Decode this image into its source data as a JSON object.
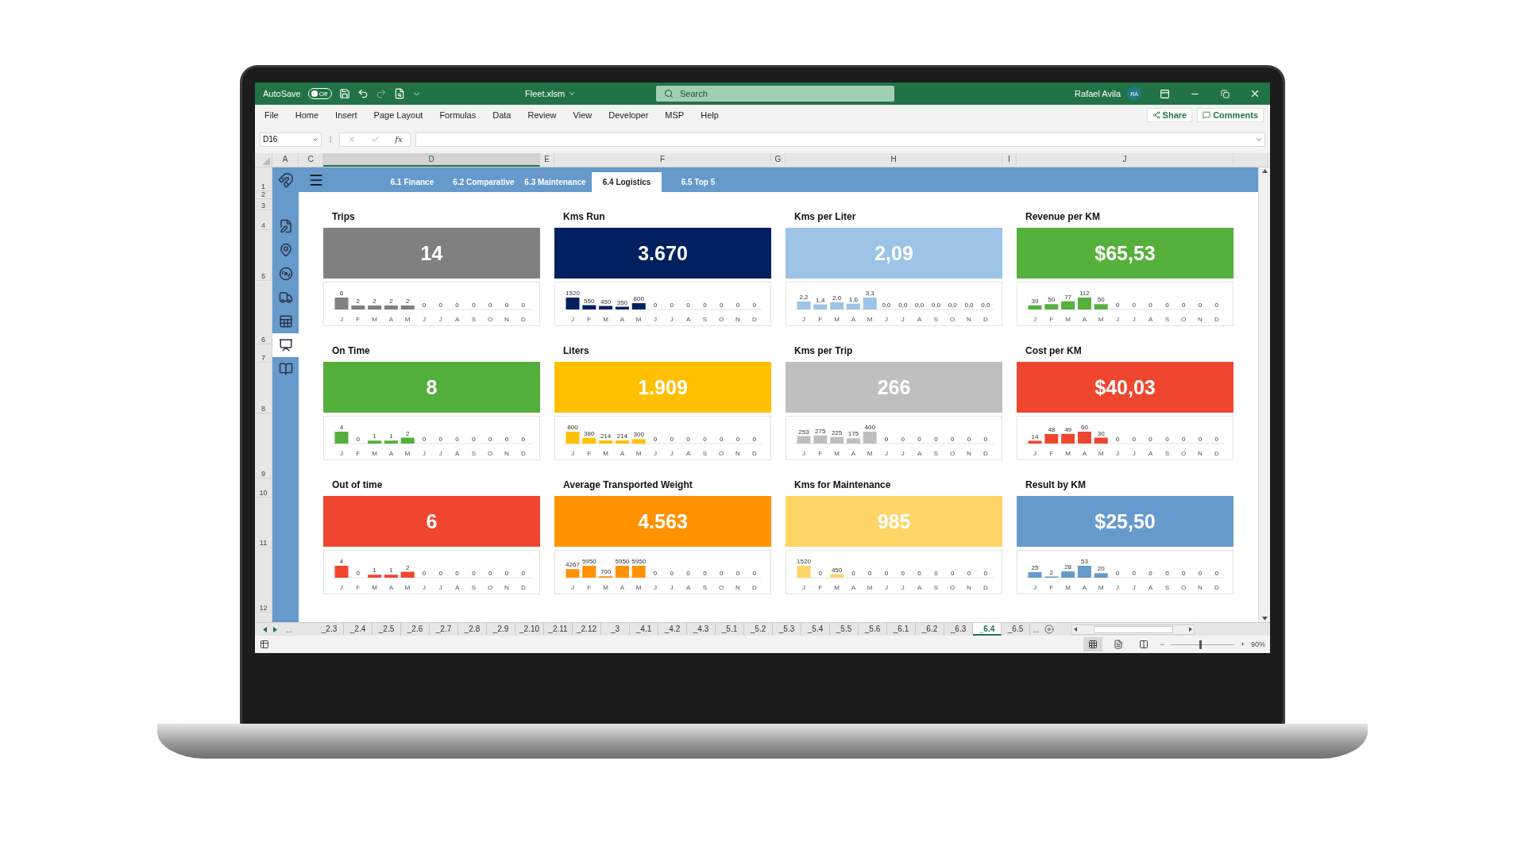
{
  "title_bar": {
    "autosave_label": "AutoSave",
    "autosave": {
      "on": false,
      "label": "Off"
    },
    "redo": {
      "disabled": true
    },
    "file_name": "Fleet.xlsm",
    "search": {
      "placeholder": "Search"
    },
    "user_name": "Rafael Avila",
    "user_initials": "RA"
  },
  "menu": {
    "items": [
      "File",
      "Home",
      "Insert",
      "Page Layout",
      "Formulas",
      "Data",
      "Review",
      "View",
      "Developer",
      "MSP",
      "Help"
    ],
    "buttons": [
      "Share",
      "Comments"
    ]
  },
  "formula_bar": {
    "name_box": "D16",
    "function_label": "fx"
  },
  "column_headers": [
    {
      "label": "A",
      "selected": false
    },
    {
      "label": "C",
      "selected": false
    },
    {
      "label": "D",
      "selected": true
    },
    {
      "label": "E",
      "selected": false
    },
    {
      "label": "F",
      "selected": false
    },
    {
      "label": "G",
      "selected": false
    },
    {
      "label": "H",
      "selected": false
    },
    {
      "label": "I",
      "selected": false
    },
    {
      "label": "J",
      "selected": false
    }
  ],
  "row_headers": [
    "1",
    "2",
    "3",
    "4",
    "5",
    "6",
    "7",
    "8",
    "9",
    "10",
    "11",
    "12"
  ],
  "dashboard": {
    "tabs": [
      {
        "label": "6.1 Finance",
        "selected": false
      },
      {
        "label": "6.2 Comparative",
        "selected": false
      },
      {
        "label": "6.3 Maintenance",
        "selected": false
      },
      {
        "label": "6.4 Logistics",
        "selected": true
      },
      {
        "label": "6.5 Top 5",
        "selected": false
      }
    ],
    "sidebar": [
      {
        "selected": false
      },
      {
        "selected": false
      },
      {
        "selected": false
      },
      {
        "selected": false
      },
      {
        "selected": false
      },
      {
        "selected": true
      },
      {
        "selected": false
      }
    ],
    "cards": [
      {
        "title": "Trips",
        "value": "14",
        "color": "#808080",
        "chart_data": {
          "type": "bar",
          "categories": [
            "J",
            "F",
            "M",
            "A",
            "M",
            "J",
            "J",
            "A",
            "S",
            "O",
            "N",
            "D"
          ],
          "values": [
            6,
            2,
            2,
            2,
            2,
            0,
            0,
            0,
            0,
            0,
            0,
            0
          ],
          "value_labels": [
            "6",
            "2",
            "2",
            "2",
            "2",
            "0",
            "0",
            "0",
            "0",
            "0",
            "0",
            "0"
          ]
        }
      },
      {
        "title": "Kms Run",
        "value": "3.670",
        "color": "#002060",
        "chart_data": {
          "type": "bar",
          "categories": [
            "J",
            "F",
            "M",
            "A",
            "M",
            "J",
            "J",
            "A",
            "S",
            "O",
            "N",
            "D"
          ],
          "values": [
            1520,
            550,
            450,
            350,
            800,
            0,
            0,
            0,
            0,
            0,
            0,
            0
          ],
          "value_labels": [
            "1520",
            "550",
            "450",
            "350",
            "800",
            "0",
            "0",
            "0",
            "0",
            "0",
            "0",
            "0"
          ]
        }
      },
      {
        "title": "Kms per Liter",
        "value": "2,09",
        "color": "#9dc3e6",
        "chart_data": {
          "type": "bar",
          "categories": [
            "J",
            "F",
            "M",
            "A",
            "M",
            "J",
            "J",
            "A",
            "S",
            "O",
            "N",
            "D"
          ],
          "values": [
            2.2,
            1.4,
            2.0,
            1.6,
            3.3,
            0,
            0,
            0,
            0,
            0,
            0,
            0
          ],
          "value_labels": [
            "2,2",
            "1,4",
            "2,0",
            "1,6",
            "3,3",
            "0,0",
            "0,0",
            "0,0",
            "0,0",
            "0,0",
            "0,0",
            "0,0"
          ]
        }
      },
      {
        "title": "Revenue per KM",
        "value": "$65,53",
        "color": "#55b03c",
        "chart_data": {
          "type": "bar",
          "categories": [
            "J",
            "F",
            "M",
            "A",
            "M",
            "J",
            "J",
            "A",
            "S",
            "O",
            "N",
            "D"
          ],
          "values": [
            39,
            50,
            77,
            112,
            50,
            0,
            0,
            0,
            0,
            0,
            0,
            0
          ],
          "value_labels": [
            "39",
            "50",
            "77",
            "112",
            "50",
            "0",
            "0",
            "0",
            "0",
            "0",
            "0",
            "0"
          ]
        }
      },
      {
        "title": "On Time",
        "value": "8",
        "color": "#54ae3a",
        "chart_data": {
          "type": "bar",
          "categories": [
            "J",
            "F",
            "M",
            "A",
            "M",
            "J",
            "J",
            "A",
            "S",
            "O",
            "N",
            "D"
          ],
          "values": [
            4,
            0,
            1,
            1,
            2,
            0,
            0,
            0,
            0,
            0,
            0,
            0
          ],
          "value_labels": [
            "4",
            "0",
            "1",
            "1",
            "2",
            "0",
            "0",
            "0",
            "0",
            "0",
            "0",
            "0"
          ]
        }
      },
      {
        "title": "Liters",
        "value": "1.909",
        "color": "#ffc000",
        "chart_data": {
          "type": "bar",
          "categories": [
            "J",
            "F",
            "M",
            "A",
            "M",
            "J",
            "J",
            "A",
            "S",
            "O",
            "N",
            "D"
          ],
          "values": [
            800,
            380,
            214,
            214,
            300,
            0,
            0,
            0,
            0,
            0,
            0,
            0
          ],
          "value_labels": [
            "800",
            "380",
            "214",
            "214",
            "300",
            "0",
            "0",
            "0",
            "0",
            "0",
            "0",
            "0"
          ]
        }
      },
      {
        "title": "Kms per Trip",
        "value": "266",
        "color": "#bfbfbf",
        "chart_data": {
          "type": "bar",
          "categories": [
            "J",
            "F",
            "M",
            "A",
            "M",
            "J",
            "J",
            "A",
            "S",
            "O",
            "N",
            "D"
          ],
          "values": [
            253,
            275,
            225,
            175,
            400,
            0,
            0,
            0,
            0,
            0,
            0,
            0
          ],
          "value_labels": [
            "253",
            "275",
            "225",
            "175",
            "400",
            "0",
            "0",
            "0",
            "0",
            "0",
            "0",
            "0"
          ]
        }
      },
      {
        "title": "Cost per KM",
        "value": "$40,03",
        "color": "#ef462f",
        "chart_data": {
          "type": "bar",
          "categories": [
            "J",
            "F",
            "M",
            "A",
            "M",
            "J",
            "J",
            "A",
            "S",
            "O",
            "N",
            "D"
          ],
          "values": [
            14,
            48,
            49,
            60,
            30,
            0,
            0,
            0,
            0,
            0,
            0,
            0
          ],
          "value_labels": [
            "14",
            "48",
            "49",
            "60",
            "30",
            "0",
            "0",
            "0",
            "0",
            "0",
            "0",
            "0"
          ]
        }
      },
      {
        "title": "Out of time",
        "value": "6",
        "color": "#f0452e",
        "chart_data": {
          "type": "bar",
          "categories": [
            "J",
            "F",
            "M",
            "A",
            "M",
            "J",
            "J",
            "A",
            "S",
            "O",
            "N",
            "D"
          ],
          "values": [
            4,
            0,
            1,
            1,
            2,
            0,
            0,
            0,
            0,
            0,
            0,
            0
          ],
          "value_labels": [
            "4",
            "0",
            "1",
            "1",
            "2",
            "0",
            "0",
            "0",
            "0",
            "0",
            "0",
            "0"
          ]
        }
      },
      {
        "title": "Average Transported Weight",
        "value": "4.563",
        "color": "#ff9200",
        "chart_data": {
          "type": "bar",
          "categories": [
            "J",
            "F",
            "M",
            "A",
            "M",
            "J",
            "J",
            "A",
            "S",
            "O",
            "N",
            "D"
          ],
          "values": [
            4267,
            5950,
            700,
            5950,
            5950,
            0,
            0,
            0,
            0,
            0,
            0,
            0
          ],
          "value_labels": [
            "4267",
            "5950",
            "700",
            "5950",
            "5950",
            "0",
            "0",
            "0",
            "0",
            "0",
            "0",
            "0"
          ]
        }
      },
      {
        "title": "Kms for Maintenance",
        "value": "985",
        "color": "#fdd567",
        "chart_data": {
          "type": "bar",
          "categories": [
            "J",
            "F",
            "M",
            "A",
            "M",
            "J",
            "J",
            "A",
            "S",
            "O",
            "N",
            "D"
          ],
          "values": [
            1520,
            0,
            450,
            0,
            0,
            0,
            0,
            0,
            0,
            0,
            0,
            0
          ],
          "value_labels": [
            "1520",
            "0",
            "450",
            "0",
            "0",
            "0",
            "0",
            "0",
            "0",
            "0",
            "0",
            "0"
          ]
        }
      },
      {
        "title": "Result by KM",
        "value": "$25,50",
        "color": "#6699cc",
        "chart_data": {
          "type": "bar",
          "categories": [
            "J",
            "F",
            "M",
            "A",
            "M",
            "J",
            "J",
            "A",
            "S",
            "O",
            "N",
            "D"
          ],
          "values": [
            25,
            2,
            28,
            53,
            20,
            0,
            0,
            0,
            0,
            0,
            0,
            0
          ],
          "value_labels": [
            "25",
            "2",
            "28",
            "53",
            "20",
            "0",
            "0",
            "0",
            "0",
            "0",
            "0",
            "0"
          ]
        }
      }
    ]
  },
  "sheet_tabs": {
    "more_before": "...",
    "tabs": [
      {
        "label": "_2.3",
        "selected": false
      },
      {
        "label": "_2.4",
        "selected": false
      },
      {
        "label": "_2.5",
        "selected": false
      },
      {
        "label": "_2.6",
        "selected": false
      },
      {
        "label": "_2.7",
        "selected": false
      },
      {
        "label": "_2.8",
        "selected": false
      },
      {
        "label": "_2.9",
        "selected": false
      },
      {
        "label": "_2.10",
        "selected": false
      },
      {
        "label": "_2.11",
        "selected": false
      },
      {
        "label": "_2.12",
        "selected": false
      },
      {
        "label": "_3",
        "selected": false
      },
      {
        "label": "_4.1",
        "selected": false
      },
      {
        "label": "_4.2",
        "selected": false
      },
      {
        "label": "_4.3",
        "selected": false
      },
      {
        "label": "_5.1",
        "selected": false
      },
      {
        "label": "_5.2",
        "selected": false
      },
      {
        "label": "_5.3",
        "selected": false
      },
      {
        "label": "_5.4",
        "selected": false
      },
      {
        "label": "_5.5",
        "selected": false
      },
      {
        "label": "_5.6",
        "selected": false
      },
      {
        "label": "_6.1",
        "selected": false
      },
      {
        "label": "_6.2",
        "selected": false
      },
      {
        "label": "_6.3",
        "selected": false
      },
      {
        "label": "_6.4",
        "selected": true
      },
      {
        "label": "_6.5",
        "selected": false
      }
    ],
    "more_after": "..."
  },
  "status_bar": {
    "zoom_out": "−",
    "zoom_in": "+",
    "zoom": {
      "level": 0.45,
      "reading": "90%"
    }
  }
}
